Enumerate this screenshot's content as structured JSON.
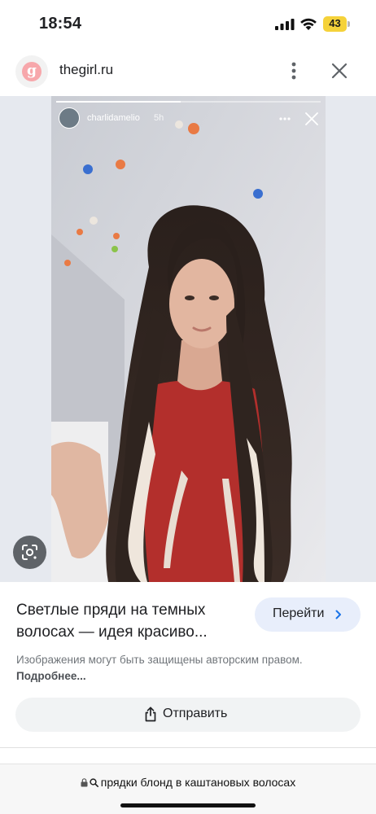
{
  "status_bar": {
    "time": "18:54",
    "battery_level": "43",
    "battery_color": "#f5d23a",
    "icons": [
      "signal-icon",
      "wifi-icon",
      "battery-icon"
    ]
  },
  "header": {
    "site_logo_letter": "g",
    "site_name": "thegirl.ru",
    "icons": [
      "more-vertical-icon",
      "close-icon"
    ]
  },
  "story": {
    "username": "charlidamelio",
    "time_ago": "5h",
    "progress": 0.47,
    "icons": [
      "more-horizontal-icon",
      "close-icon"
    ]
  },
  "lens": {
    "icon": "lens-icon"
  },
  "result": {
    "title": "Светлые пряди на темных волосах — идея красиво...",
    "visit_label": "Перейти",
    "copyright_text": "Изображения могут быть защищены авторским правом.",
    "more_link": "Подробнее...",
    "share_label": "Отправить"
  },
  "url_bar": {
    "query": "прядки блонд в каштановых волосах",
    "icons": [
      "lock-icon",
      "search-icon"
    ]
  },
  "colors": {
    "visit_button_bg": "#e8eefb",
    "share_button_bg": "#f1f3f4",
    "link_accent": "#1a73e8"
  }
}
